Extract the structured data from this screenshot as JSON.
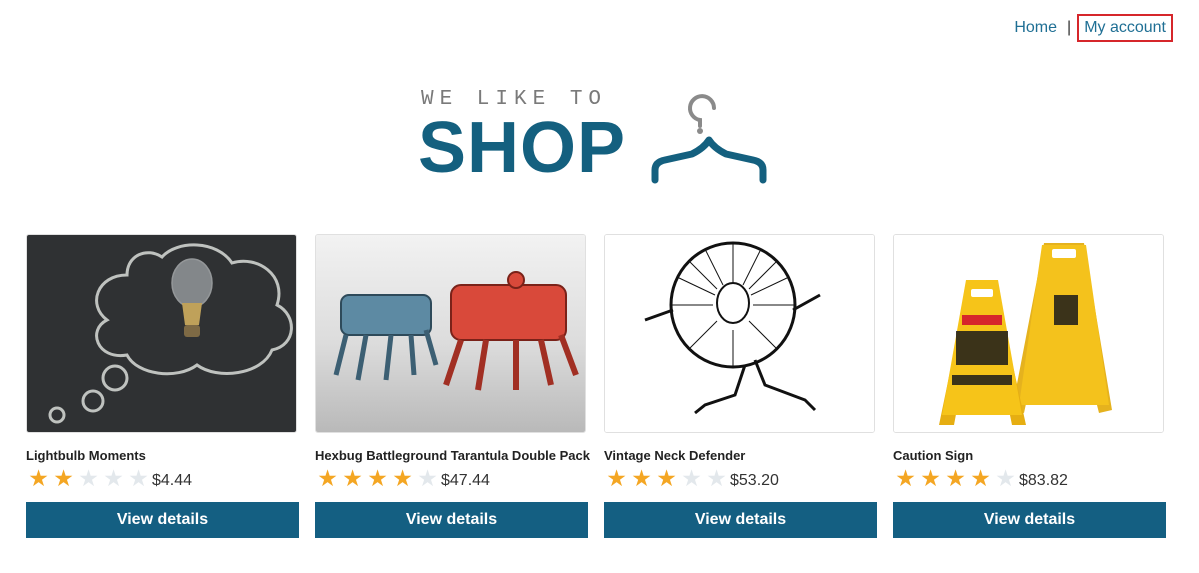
{
  "nav": {
    "home": "Home",
    "separator": "|",
    "my_account": "My account"
  },
  "logo": {
    "tagline": "WE LIKE TO",
    "word": "SHOP",
    "icon": "hanger-icon"
  },
  "colors": {
    "brand": "#14607f",
    "button": "#145f82",
    "star_on": "#f4a623",
    "star_off": "#e3e8ec",
    "highlight_border": "#d6262b"
  },
  "products": [
    {
      "name": "Lightbulb Moments",
      "rating": 2,
      "max_rating": 5,
      "price": "$4.44",
      "button": "View details",
      "image": "lightbulb-chalk-thought-bubble"
    },
    {
      "name": "Hexbug Battleground Tarantula Double Pack",
      "rating": 4,
      "max_rating": 5,
      "price": "$47.44",
      "button": "View details",
      "image": "robot-spiders"
    },
    {
      "name": "Vintage Neck Defender",
      "rating": 3,
      "max_rating": 5,
      "price": "$53.20",
      "button": "View details",
      "image": "ruff-collar-sketch"
    },
    {
      "name": "Caution Sign",
      "rating": 4,
      "max_rating": 5,
      "price": "$83.82",
      "button": "View details",
      "image": "yellow-caution-signs"
    }
  ]
}
